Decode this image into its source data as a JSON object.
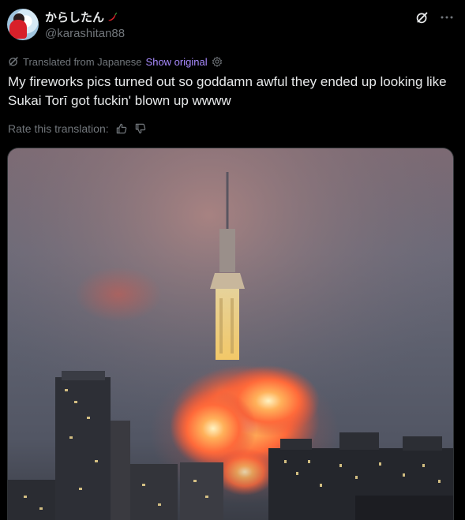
{
  "post": {
    "display_name": "からしたん",
    "handle": "@karashitan88",
    "translated_label": "Translated from Japanese",
    "show_original": "Show original",
    "text": "My fireworks pics turned out so goddamn awful they ended up looking like Sukai Torī got fuckin' blown up wwww",
    "rate_label": "Rate this translation:"
  },
  "icons": {
    "header": [
      "grok-icon",
      "more-icon"
    ],
    "translation": [
      "translate-icon",
      "gear-icon"
    ],
    "rating": [
      "thumbs-up-icon",
      "thumbs-down-icon"
    ]
  },
  "colors": {
    "background": "#000000",
    "text_primary": "#e7e9ea",
    "text_secondary": "#71767b",
    "link_accent": "#a98bff"
  }
}
